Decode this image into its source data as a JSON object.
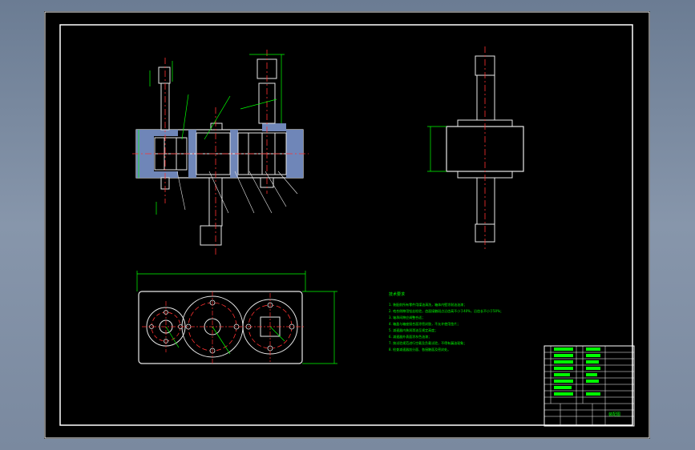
{
  "colors": {
    "background": "#000000",
    "frame": "#ffffff",
    "geometry": "#e8e8e8",
    "dimension": "#00ff00",
    "centerline": "#ff3030",
    "hatch": "#6f86b8",
    "bearing": "#4a6ed0",
    "notes": "#00ff00"
  },
  "notes": {
    "heading": "技术要求",
    "lines": [
      "1. 装配前所有零件用煤油清洗，箱体内壁涂耐油油漆；",
      "2. 啮合侧隙用铅丝检验，齿面接触斑点沿齿高不小于40%，沿齿长不小于50%；",
      "3. 轴承间隙应调整合适；",
      "4. 箱盖与箱座接合面涂密封胶，不允许使用垫片；",
      "5. 减速器内装润滑油至规定高度；",
      "6. 减速器外表面涂灰色油漆；",
      "7. 按试验规范进行空载及负载试验，不得有漏油现象；",
      "8. 检查减速器剖分面、各接触面及密封处。"
    ]
  },
  "title_block": {
    "label": "装配图"
  }
}
